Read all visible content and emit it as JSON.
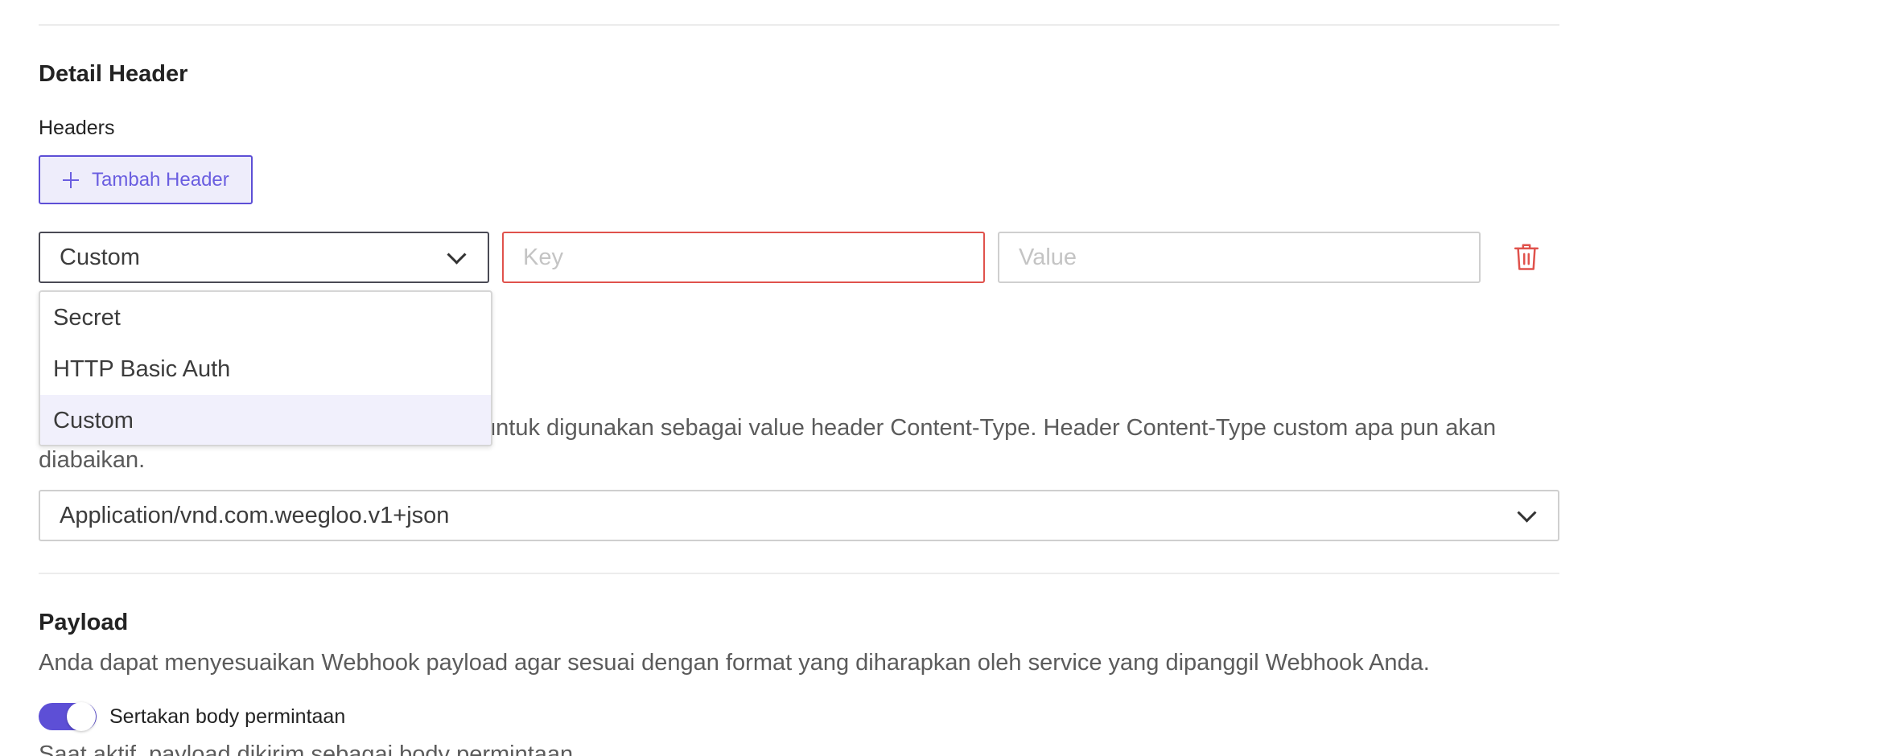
{
  "detail_header": {
    "title": "Detail Header",
    "headers_label": "Headers",
    "add_button_label": "Tambah Header",
    "row": {
      "type_value": "Custom",
      "key_placeholder": "Key",
      "value_placeholder": "Value"
    },
    "type_options": [
      "Secret",
      "HTTP Basic Auth",
      "Custom"
    ],
    "selected_option": "Custom",
    "content_type_helper": "untuk digunakan sebagai value header Content-Type. Header Content-Type custom apa pun akan",
    "content_type_helper_line2": "diabaikan.",
    "content_type_value": "Application/vnd.com.weegloo.v1+json"
  },
  "payload": {
    "title": "Payload",
    "description": "Anda dapat menyesuaikan Webhook payload agar sesuai dengan format yang diharapkan oleh service yang dipanggil Webhook Anda.",
    "toggle_label": "Sertakan body permintaan",
    "toggle_on": true,
    "toggle_helper": "Saat aktif, payload dikirim sebagai body permintaan."
  },
  "colors": {
    "accent": "#5d4fd6",
    "error": "#e0524c",
    "selected_bg": "#f1f0fc"
  },
  "icons": {
    "add": "plus-icon",
    "dropdown": "chevron-down-icon",
    "delete": "trash-icon"
  }
}
